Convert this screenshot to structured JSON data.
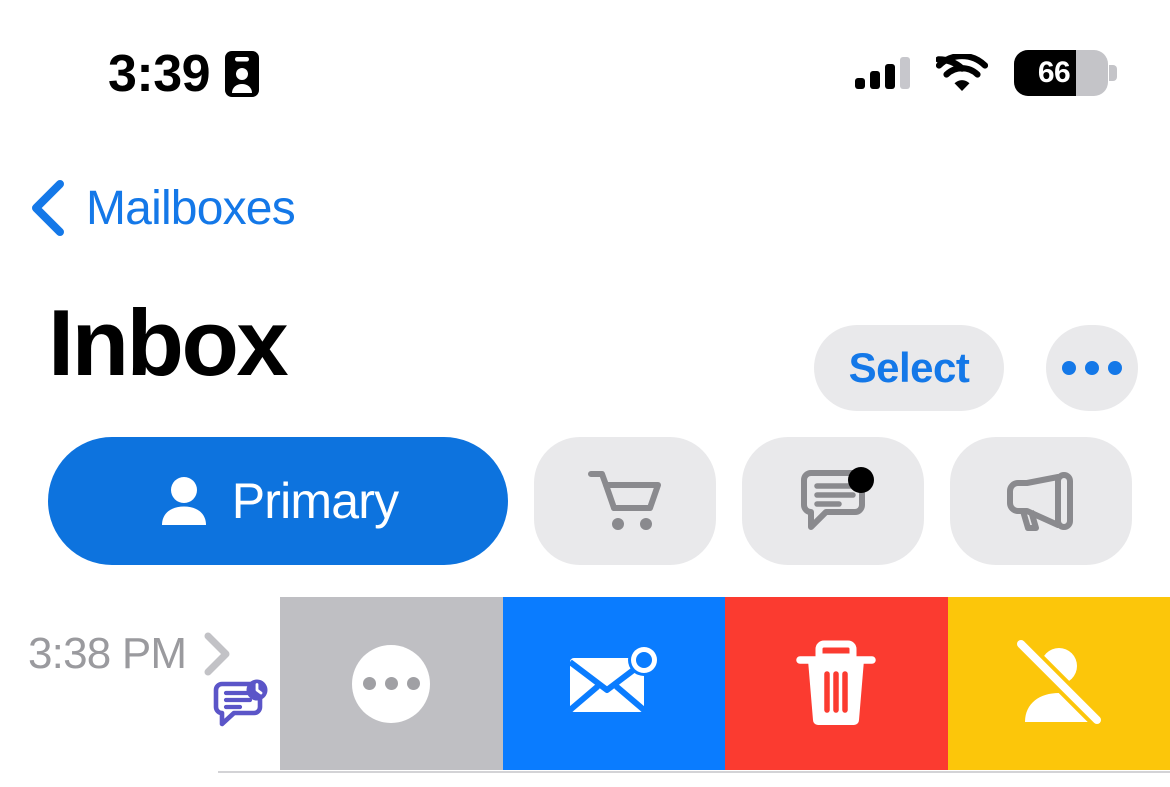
{
  "status_bar": {
    "time": "3:39",
    "location_icon": "contact-card-icon",
    "signal_icon": "cellular-signal-icon",
    "signal_bars_filled": 3,
    "signal_bars_total": 4,
    "wifi_icon": "wifi-icon",
    "battery_percent": "66",
    "battery_level": 66
  },
  "nav_bar": {
    "back_icon": "chevron-left-icon",
    "back_label": "Mailboxes",
    "select_label": "Select",
    "more_icon": "ellipsis-icon"
  },
  "page": {
    "title": "Inbox"
  },
  "categories": [
    {
      "id": "primary",
      "label": "Primary",
      "icon": "person-icon",
      "selected": true,
      "badge": false
    },
    {
      "id": "transactions",
      "label": "",
      "icon": "shopping-cart-icon",
      "selected": false,
      "badge": false
    },
    {
      "id": "updates",
      "label": "",
      "icon": "chat-bubble-icon",
      "selected": false,
      "badge": true
    },
    {
      "id": "promotions",
      "label": "",
      "icon": "megaphone-icon",
      "selected": false,
      "badge": false
    }
  ],
  "mail_row": {
    "timestamp": "3:38 PM",
    "disclosure_icon": "chevron-right-icon",
    "category_icon": "chat-bubble-clock-icon"
  },
  "swipe_actions": [
    {
      "id": "more",
      "icon": "ellipsis-circle-icon",
      "color": "#BFBFC3"
    },
    {
      "id": "unread",
      "icon": "envelope-badge-icon",
      "color": "#0A7CFF"
    },
    {
      "id": "trash",
      "icon": "trash-icon",
      "color": "#FB3B30"
    },
    {
      "id": "block",
      "icon": "person-slash-icon",
      "color": "#FCC60A"
    }
  ],
  "colors": {
    "accent_blue": "#1478E8",
    "primary_pill": "#0D73DE",
    "chip_gray": "#E9E9EB",
    "icon_gray": "#8A8A8E",
    "badge_purple": "#5B55C8",
    "muted_text": "#9A9A9E"
  }
}
